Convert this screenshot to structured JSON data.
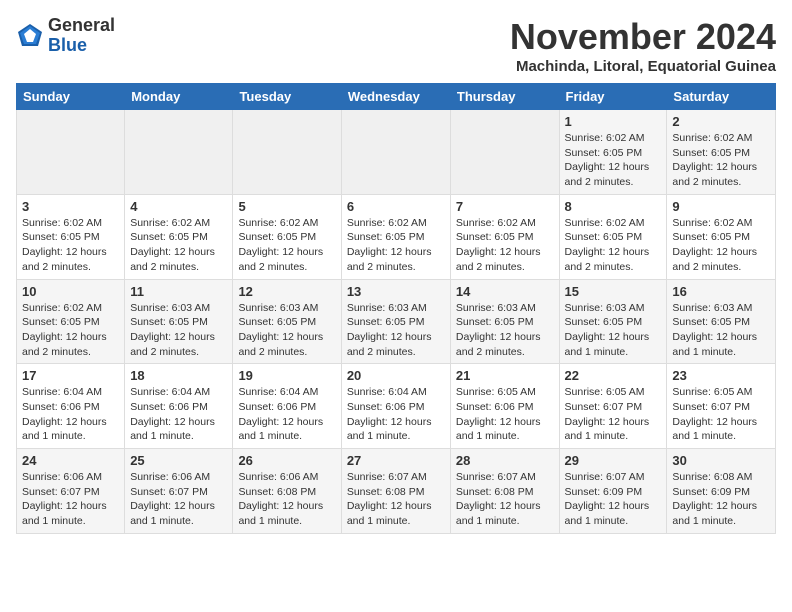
{
  "header": {
    "logo_line1": "General",
    "logo_line2": "Blue",
    "month_title": "November 2024",
    "location": "Machinda, Litoral, Equatorial Guinea"
  },
  "days_of_week": [
    "Sunday",
    "Monday",
    "Tuesday",
    "Wednesday",
    "Thursday",
    "Friday",
    "Saturday"
  ],
  "weeks": [
    [
      {
        "day": "",
        "info": ""
      },
      {
        "day": "",
        "info": ""
      },
      {
        "day": "",
        "info": ""
      },
      {
        "day": "",
        "info": ""
      },
      {
        "day": "",
        "info": ""
      },
      {
        "day": "1",
        "info": "Sunrise: 6:02 AM\nSunset: 6:05 PM\nDaylight: 12 hours and 2 minutes."
      },
      {
        "day": "2",
        "info": "Sunrise: 6:02 AM\nSunset: 6:05 PM\nDaylight: 12 hours and 2 minutes."
      }
    ],
    [
      {
        "day": "3",
        "info": "Sunrise: 6:02 AM\nSunset: 6:05 PM\nDaylight: 12 hours and 2 minutes."
      },
      {
        "day": "4",
        "info": "Sunrise: 6:02 AM\nSunset: 6:05 PM\nDaylight: 12 hours and 2 minutes."
      },
      {
        "day": "5",
        "info": "Sunrise: 6:02 AM\nSunset: 6:05 PM\nDaylight: 12 hours and 2 minutes."
      },
      {
        "day": "6",
        "info": "Sunrise: 6:02 AM\nSunset: 6:05 PM\nDaylight: 12 hours and 2 minutes."
      },
      {
        "day": "7",
        "info": "Sunrise: 6:02 AM\nSunset: 6:05 PM\nDaylight: 12 hours and 2 minutes."
      },
      {
        "day": "8",
        "info": "Sunrise: 6:02 AM\nSunset: 6:05 PM\nDaylight: 12 hours and 2 minutes."
      },
      {
        "day": "9",
        "info": "Sunrise: 6:02 AM\nSunset: 6:05 PM\nDaylight: 12 hours and 2 minutes."
      }
    ],
    [
      {
        "day": "10",
        "info": "Sunrise: 6:02 AM\nSunset: 6:05 PM\nDaylight: 12 hours and 2 minutes."
      },
      {
        "day": "11",
        "info": "Sunrise: 6:03 AM\nSunset: 6:05 PM\nDaylight: 12 hours and 2 minutes."
      },
      {
        "day": "12",
        "info": "Sunrise: 6:03 AM\nSunset: 6:05 PM\nDaylight: 12 hours and 2 minutes."
      },
      {
        "day": "13",
        "info": "Sunrise: 6:03 AM\nSunset: 6:05 PM\nDaylight: 12 hours and 2 minutes."
      },
      {
        "day": "14",
        "info": "Sunrise: 6:03 AM\nSunset: 6:05 PM\nDaylight: 12 hours and 2 minutes."
      },
      {
        "day": "15",
        "info": "Sunrise: 6:03 AM\nSunset: 6:05 PM\nDaylight: 12 hours and 1 minute."
      },
      {
        "day": "16",
        "info": "Sunrise: 6:03 AM\nSunset: 6:05 PM\nDaylight: 12 hours and 1 minute."
      }
    ],
    [
      {
        "day": "17",
        "info": "Sunrise: 6:04 AM\nSunset: 6:06 PM\nDaylight: 12 hours and 1 minute."
      },
      {
        "day": "18",
        "info": "Sunrise: 6:04 AM\nSunset: 6:06 PM\nDaylight: 12 hours and 1 minute."
      },
      {
        "day": "19",
        "info": "Sunrise: 6:04 AM\nSunset: 6:06 PM\nDaylight: 12 hours and 1 minute."
      },
      {
        "day": "20",
        "info": "Sunrise: 6:04 AM\nSunset: 6:06 PM\nDaylight: 12 hours and 1 minute."
      },
      {
        "day": "21",
        "info": "Sunrise: 6:05 AM\nSunset: 6:06 PM\nDaylight: 12 hours and 1 minute."
      },
      {
        "day": "22",
        "info": "Sunrise: 6:05 AM\nSunset: 6:07 PM\nDaylight: 12 hours and 1 minute."
      },
      {
        "day": "23",
        "info": "Sunrise: 6:05 AM\nSunset: 6:07 PM\nDaylight: 12 hours and 1 minute."
      }
    ],
    [
      {
        "day": "24",
        "info": "Sunrise: 6:06 AM\nSunset: 6:07 PM\nDaylight: 12 hours and 1 minute."
      },
      {
        "day": "25",
        "info": "Sunrise: 6:06 AM\nSunset: 6:07 PM\nDaylight: 12 hours and 1 minute."
      },
      {
        "day": "26",
        "info": "Sunrise: 6:06 AM\nSunset: 6:08 PM\nDaylight: 12 hours and 1 minute."
      },
      {
        "day": "27",
        "info": "Sunrise: 6:07 AM\nSunset: 6:08 PM\nDaylight: 12 hours and 1 minute."
      },
      {
        "day": "28",
        "info": "Sunrise: 6:07 AM\nSunset: 6:08 PM\nDaylight: 12 hours and 1 minute."
      },
      {
        "day": "29",
        "info": "Sunrise: 6:07 AM\nSunset: 6:09 PM\nDaylight: 12 hours and 1 minute."
      },
      {
        "day": "30",
        "info": "Sunrise: 6:08 AM\nSunset: 6:09 PM\nDaylight: 12 hours and 1 minute."
      }
    ]
  ]
}
